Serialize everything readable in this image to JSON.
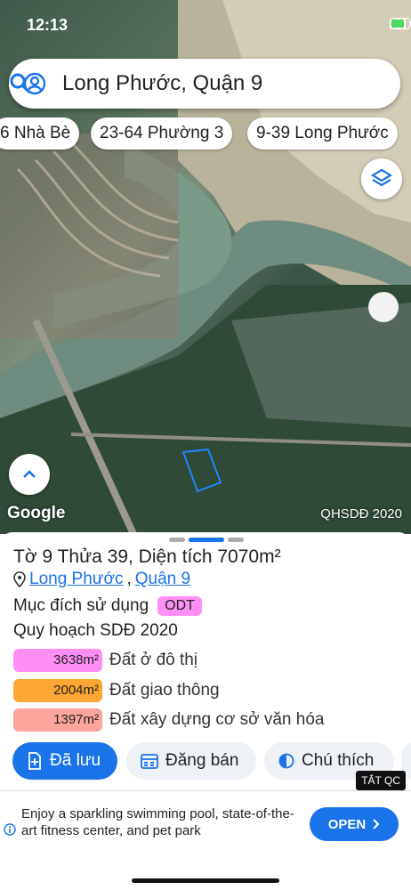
{
  "status_bar": {
    "time": "12:13"
  },
  "search": {
    "query": "Long Phước, Quận 9"
  },
  "chips": [
    "6 Nhà Bè",
    "23-64 Phường 3",
    "9-39 Long Phước"
  ],
  "map": {
    "attribution": "Google",
    "layer_label": "QHSDĐ 2020"
  },
  "parcel": {
    "title": "Tờ 9 Thửa 39, Diện tích 7070m²",
    "location_ward": "Long Phước",
    "location_sep": ",",
    "location_district": "Quận 9",
    "purpose_label": "Mục đích sử dụng",
    "purpose_badge": "ODT",
    "plan_title": "Quy hoạch SDĐ 2020",
    "plan_items": [
      {
        "area": "3638m²",
        "label": "Đất ở đô thị",
        "color": "#ff8ff5"
      },
      {
        "area": "2004m²",
        "label": "Đất giao thông",
        "color": "#fca633"
      },
      {
        "area": "1397m²",
        "label": "Đất xây dựng cơ sở văn hóa",
        "color": "#fba59c"
      }
    ]
  },
  "actions": {
    "saved": "Đã lưu",
    "sell": "Đăng bán",
    "legend": "Chú thích"
  },
  "ad": {
    "close_label": "TẮT QC",
    "text": "Enjoy a sparkling swimming pool, state-of-the-art fitness center, and pet park",
    "cta": "OPEN"
  },
  "colors": {
    "accent": "#1a73e8",
    "parcel_outline": "#1e88ff"
  }
}
